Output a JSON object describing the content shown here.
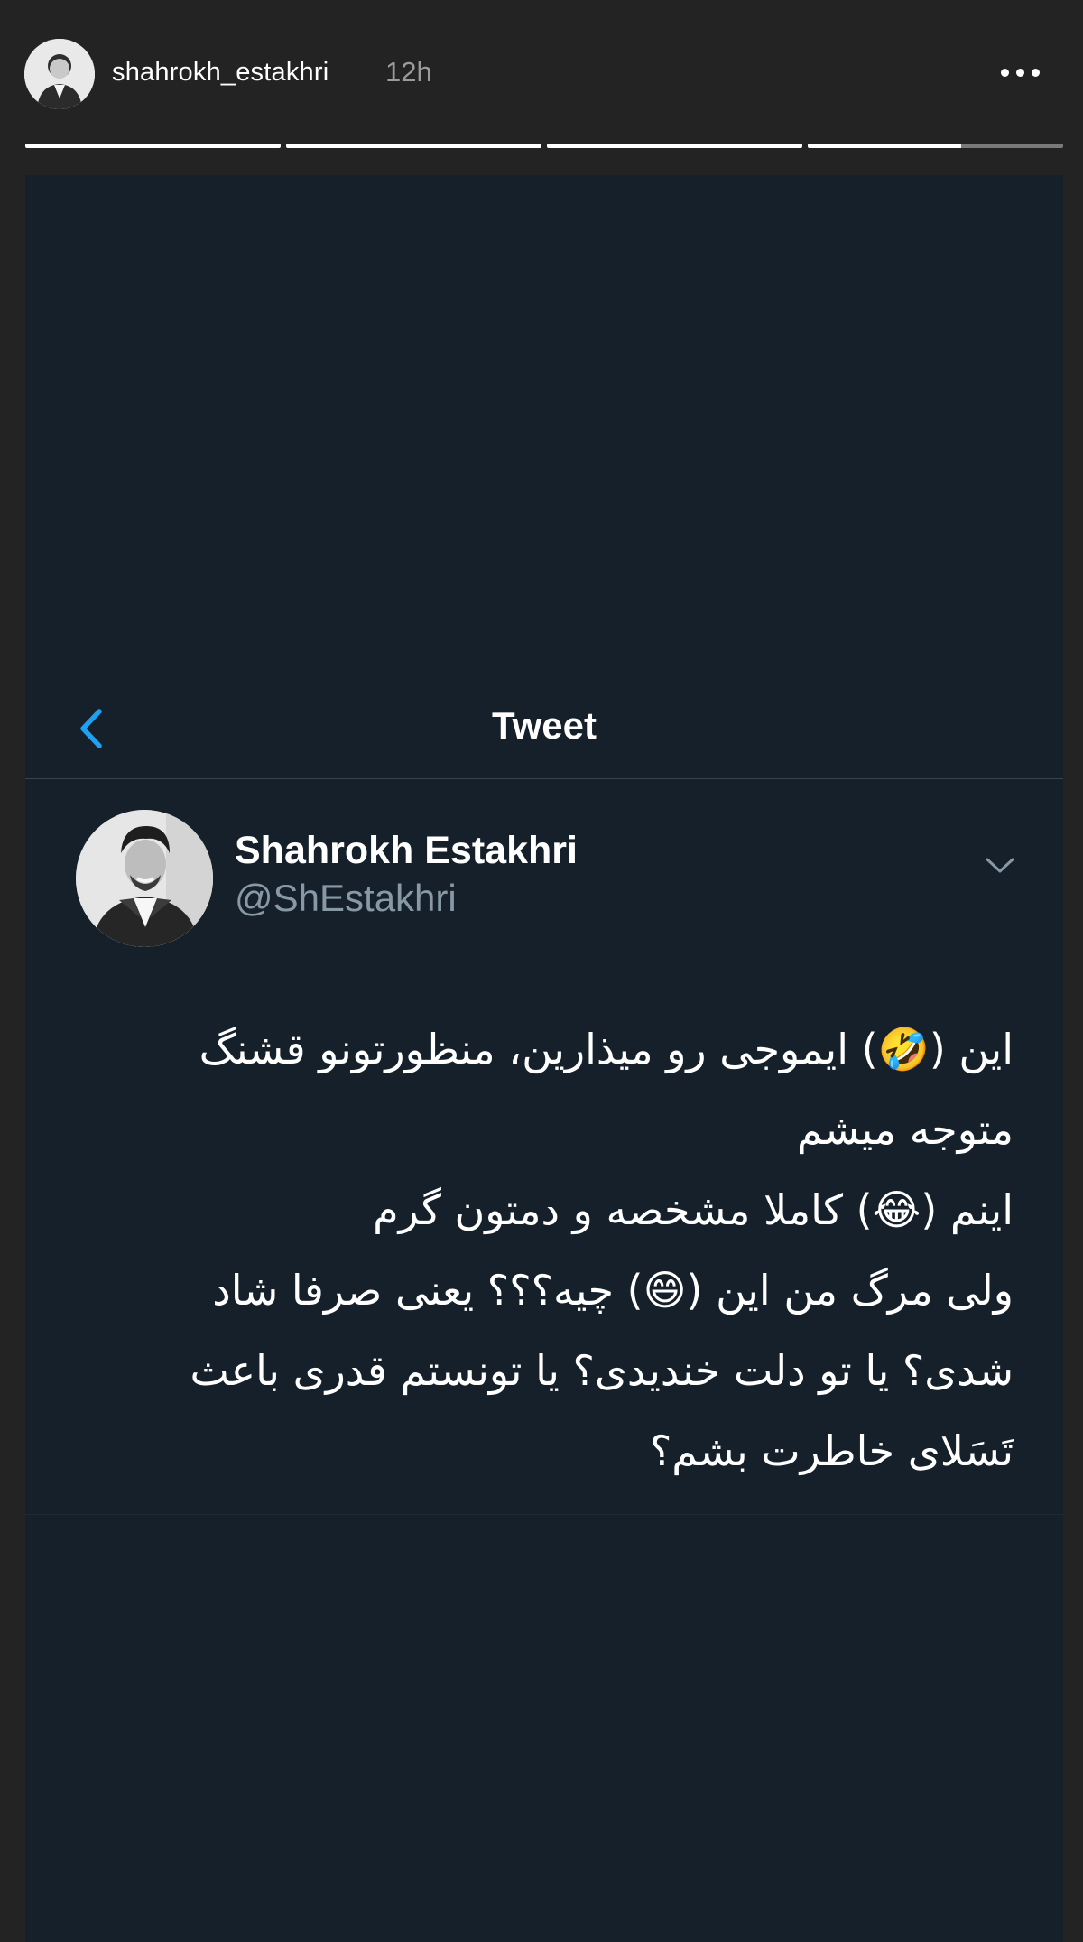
{
  "story": {
    "username": "shahrokh_estakhri",
    "time": "12h",
    "more_icon": "more-horizontal-icon",
    "progress": [
      1,
      1,
      1,
      0.6
    ]
  },
  "tweet_view": {
    "nav_title": "Tweet",
    "back_icon": "chevron-left-icon",
    "accent": "#1da1f2",
    "background": "#15202b",
    "author": {
      "name": "Shahrokh Estakhri",
      "handle": "@ShEstakhri"
    },
    "menu_icon": "chevron-down-icon",
    "lines": [
      "این (🤣) ایموجی رو میذارین، منظورتونو قشنگ",
      "متوجه میشم",
      "اینم (😂) کاملا مشخصه و دمتون گرم",
      "ولی مرگ من این (😄) چیه؟؟؟ یعنی صرفا شاد",
      "شدی؟ یا تو دلت خندیدی؟ یا تونستم قدری باعث",
      "تَسَلای خاطرت بشم؟"
    ]
  }
}
